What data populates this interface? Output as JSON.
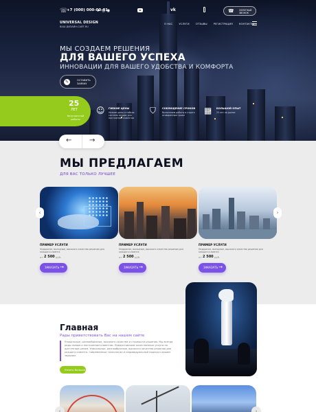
{
  "header": {
    "phone": "+7 (000) 000-00-01",
    "callback_label": "ОБРАТНЫЙ ЗВОНОК",
    "logo_name": "UNIVERSAL DESIGN",
    "logo_site": "ВАШ ДИЗАЙН-САЙТ.RU",
    "nav": [
      "О НАС",
      "УСЛУГИ",
      "ОТЗЫВЫ",
      "РЕГИСТРАЦИЯ",
      "КОНТАКТЫ"
    ]
  },
  "hero": {
    "line1": "МЫ СОЗДАЕМ РЕШЕНИЯ",
    "line2": "ДЛЯ ВАШЕГО УСПЕХА",
    "line3": "ИННОВАЦИИ ДЛЯ ВАШЕГО УДОБСТВА И КОМФОРТА",
    "cta": "ОСТАВИТЬ ЗАЯВКУ",
    "years_num": "25",
    "years_label": "ЛЕТ",
    "years_desc": "безупречной работы",
    "features": [
      {
        "title": "ГИБКИЕ ЦЕНЫ",
        "desc": "Низкие цены и гибкая система скидок для постоянных клиентов",
        "icon": "handshake-icon"
      },
      {
        "title": "СОБЛЮДЕНИЕ СРОКОВ",
        "desc": "Выполняем работы в строго оговоренные сроки",
        "icon": "shield-icon"
      },
      {
        "title": "БОЛЬШОЙ ОПЫТ",
        "desc": "25 лет на рынке",
        "icon": "chart-icon"
      }
    ]
  },
  "offers": {
    "title": "МЫ ПРЕДЛАГАЕМ",
    "subtitle": "ДЛЯ ВАС ТОЛЬКО ЛУЧШЕЕ",
    "cards": [
      {
        "title": "ПРИМЕР УСЛУГИ",
        "desc": "Недорогие, выгодные, высокого качества решения для каждого клиента",
        "from": "от",
        "price": "2 500",
        "currency": "руб.",
        "button": "ЗАКАЗАТЬ"
      },
      {
        "title": "ПРИМЕР УСЛУГИ",
        "desc": "Недорогие, выгодные, высокого качества решения для каждого клиента",
        "from": "от",
        "price": "2 500",
        "currency": "руб.",
        "button": "ЗАКАЗАТЬ"
      },
      {
        "title": "ПРИМЕР УСЛУГИ",
        "desc": "Недорогие, выгодные, высокого качества решения для каждого клиента",
        "from": "от",
        "price": "2 500",
        "currency": "руб.",
        "button": "ЗАКАЗАТЬ"
      }
    ]
  },
  "about": {
    "title": "Главная",
    "lead": "Рады приветствовать Вас на нашем сайте",
    "text": "Уникальные, разнообразные, высокого качества и стоимости решения. Мы всегда рады новым и постоянным клиентам. Предоставляем качественные услуги по доступным ценам. Уникальные, разнообразные, высокого качества решения для каждого клиента. Современные технологии и индивидуальный подход к вашим задачам.",
    "button": "Узнать больше"
  }
}
